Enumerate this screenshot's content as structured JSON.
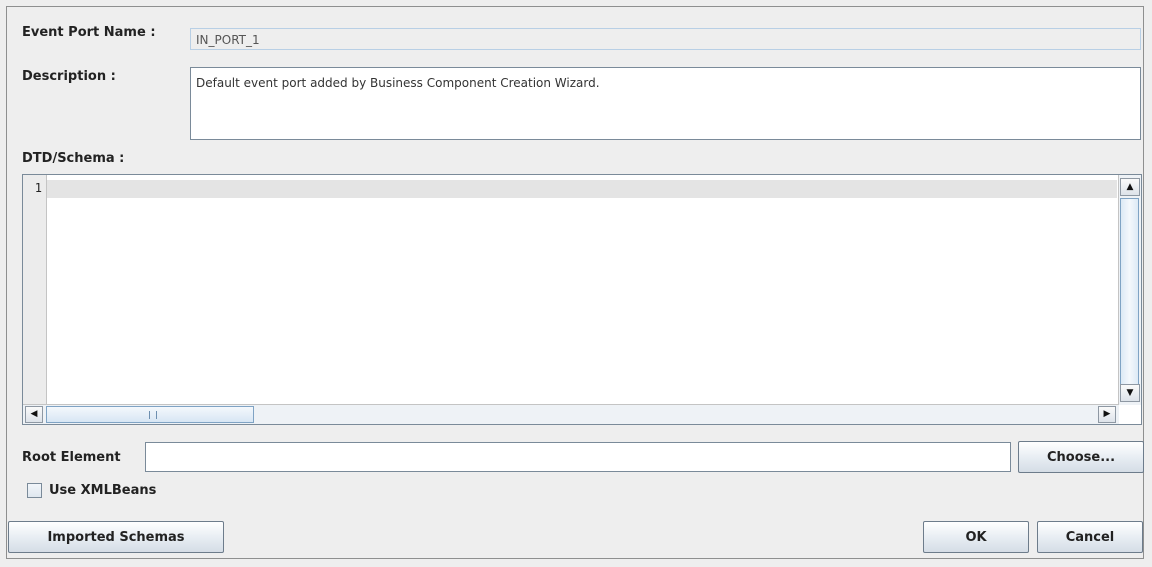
{
  "form": {
    "event_port_name_label": "Event Port Name :",
    "event_port_name_value": "IN_PORT_1",
    "description_label": "Description :",
    "description_value": "Default event port added by Business Component Creation Wizard.",
    "schema_label": "DTD/Schema :",
    "line_number": "1",
    "root_element_label": "Root Element",
    "root_element_value": "",
    "use_xmlbeans_label": "Use XMLBeans",
    "use_xmlbeans_checked": false
  },
  "buttons": {
    "choose": "Choose...",
    "imported_schemas": "Imported Schemas",
    "ok": "OK",
    "cancel": "Cancel"
  },
  "icons": {
    "scroll_up": "arrow-up-icon",
    "scroll_down": "arrow-down-icon",
    "scroll_left": "arrow-left-icon",
    "scroll_right": "arrow-right-icon"
  }
}
